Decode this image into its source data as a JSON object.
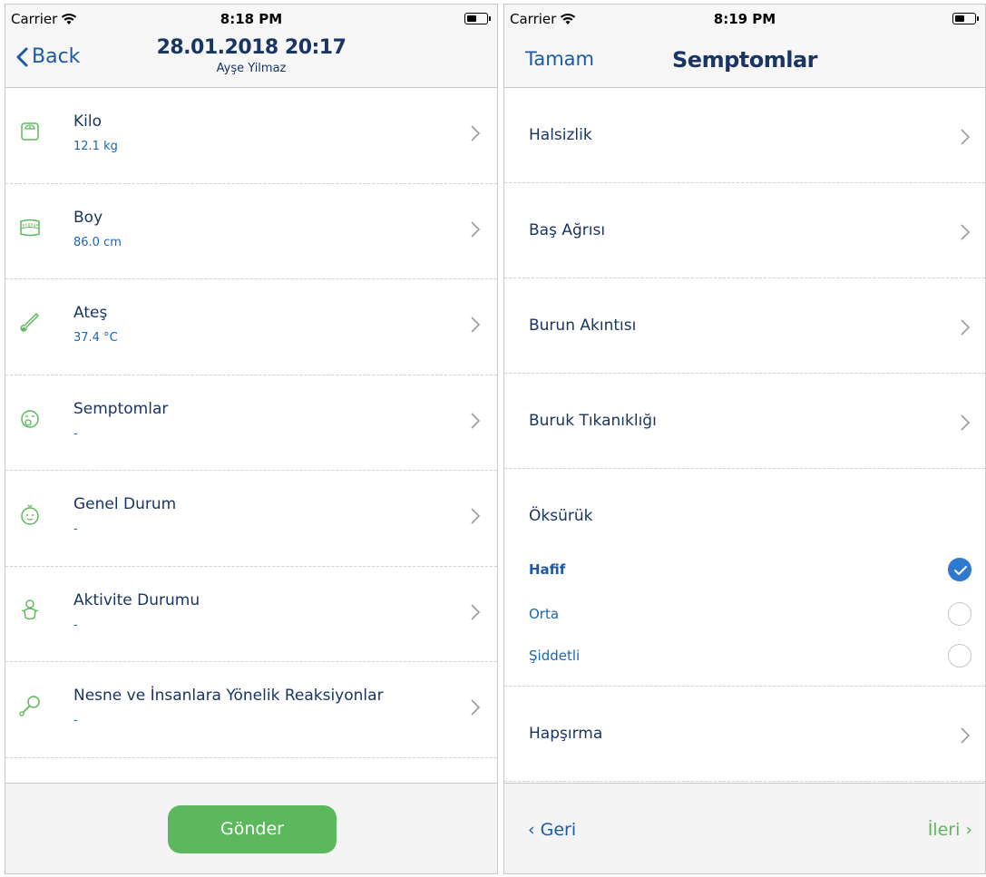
{
  "left_screen": {
    "status": {
      "carrier": "Carrier",
      "time": "8:18 PM",
      "battery_level": 0.5
    },
    "nav": {
      "back_label": "Back",
      "title": "28.01.2018 20:17",
      "subtitle": "Ayşe Yilmaz"
    },
    "items": [
      {
        "title": "Kilo",
        "value": "12.1 kg",
        "icon": "scale-icon"
      },
      {
        "title": "Boy",
        "value": "86.0 cm",
        "icon": "measuring-tape-icon"
      },
      {
        "title": "Ateş",
        "value": "37.4 °C",
        "icon": "thermometer-icon"
      },
      {
        "title": "Semptomlar",
        "value": "-",
        "icon": "sick-face-icon"
      },
      {
        "title": "Genel Durum",
        "value": "-",
        "icon": "baby-face-icon"
      },
      {
        "title": "Aktivite Durumu",
        "value": "-",
        "icon": "baby-activity-icon"
      },
      {
        "title": "Nesne ve İnsanlara Yönelik Reaksiyonlar",
        "value": "-",
        "icon": "rattle-icon"
      }
    ],
    "send_label": "Gönder",
    "accent_color": "#5cb85c"
  },
  "right_screen": {
    "status": {
      "carrier": "Carrier",
      "time": "8:19 PM",
      "battery_level": 0.5
    },
    "nav": {
      "done_label": "Tamam",
      "title": "Semptomlar"
    },
    "items": [
      {
        "title": "Halsizlik"
      },
      {
        "title": "Baş Ağrısı"
      },
      {
        "title": "Burun Akıntısı"
      },
      {
        "title": "Buruk Tıkanıklığı"
      }
    ],
    "expanded_item": {
      "title": "Öksürük",
      "options": [
        {
          "label": "Hafif",
          "selected": true
        },
        {
          "label": "Orta",
          "selected": false
        },
        {
          "label": "Şiddetli",
          "selected": false
        }
      ]
    },
    "after_items": [
      {
        "title": "Hapşırma"
      }
    ],
    "prev_label": "‹ Geri",
    "next_label": "İleri ›",
    "link_color": "#1a5aa6",
    "check_color": "#2f7ad0"
  }
}
